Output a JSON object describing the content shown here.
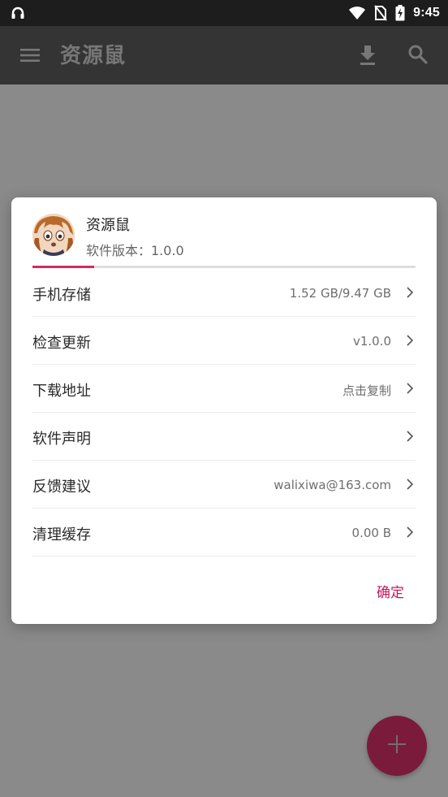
{
  "status_bar": {
    "time": "9:45",
    "icons": [
      "headset-icon",
      "wifi-icon",
      "no-sim-icon",
      "battery-charging-icon"
    ]
  },
  "app_bar": {
    "title": "资源鼠",
    "icons": [
      "menu-icon",
      "download-icon",
      "search-icon"
    ]
  },
  "dialog": {
    "app_name": "资源鼠",
    "version": "软件版本：1.0.0",
    "progress_fraction": 0.16,
    "rows": [
      {
        "label": "手机存储",
        "value": "1.52 GB/9.47 GB"
      },
      {
        "label": "检查更新",
        "value": "v1.0.0"
      },
      {
        "label": "下载地址",
        "value": "点击复制"
      },
      {
        "label": "软件声明",
        "value": ""
      },
      {
        "label": "反馈建议",
        "value": "walixiwa@163.com"
      },
      {
        "label": "清理缓存",
        "value": "0.00 B"
      }
    ],
    "confirm_label": "确定"
  },
  "colors": {
    "accent": "#c2185b",
    "fab": "#7a1b3c",
    "app_bar": "#343434",
    "status_bar": "#1d1d1d",
    "scrim": "#8a8a8a"
  },
  "fab": {
    "icon": "plus-icon"
  }
}
